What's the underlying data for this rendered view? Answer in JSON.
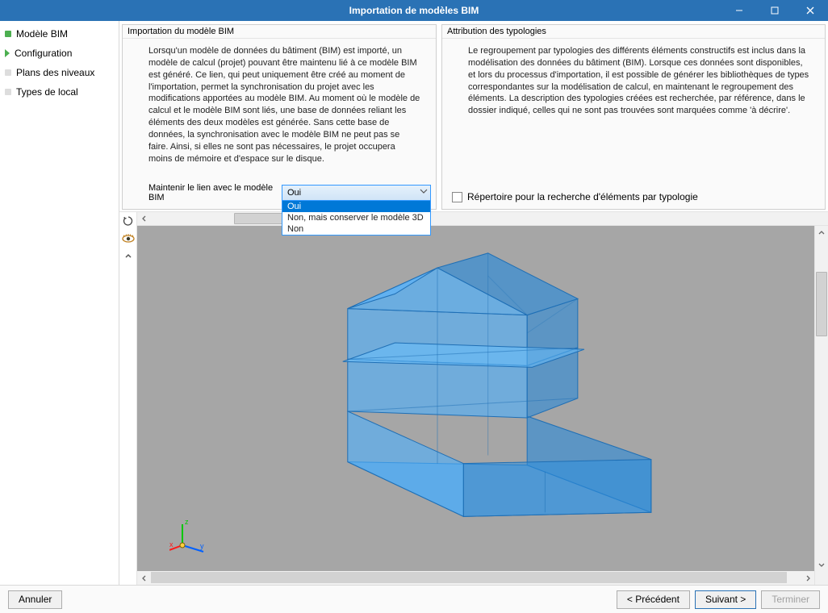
{
  "window": {
    "title": "Importation de modèles BIM"
  },
  "sidebar": {
    "items": [
      {
        "label": "Modèle BIM",
        "state": "done"
      },
      {
        "label": "Configuration",
        "state": "current"
      },
      {
        "label": "Plans des niveaux",
        "state": "pending"
      },
      {
        "label": "Types de local",
        "state": "pending"
      }
    ]
  },
  "panels": {
    "left": {
      "title": "Importation du modèle BIM",
      "text": "Lorsqu'un modèle de données du bâtiment (BIM) est importé, un modèle de calcul (projet) pouvant être maintenu lié à ce modèle BIM est généré. Ce lien, qui peut uniquement être créé au moment de l'importation, permet la synchronisation du projet avec les modifications apportées au modèle BIM. Au moment où le modèle de calcul et le modèle BIM sont liés, une base de données reliant les éléments des deux modèles est générée. Sans cette base de données, la synchronisation avec le modèle BIM ne peut pas se faire. Ainsi, si elles ne sont pas nécessaires, le projet occupera moins de mémoire et d'espace sur le disque.",
      "comboLabel": "Maintenir le lien avec le modèle BIM",
      "comboValue": "Oui",
      "comboOptions": [
        "Oui",
        "Non, mais conserver le modèle 3D",
        "Non"
      ]
    },
    "right": {
      "title": "Attribution des typologies",
      "text": "Le regroupement par typologies des différents éléments constructifs est inclus dans la modélisation des données du bâtiment (BIM). Lorsque ces données sont disponibles, et lors du processus d'importation, il est possible de générer les bibliothèques de types correspondantes sur la modélisation de calcul, en maintenant le regroupement des éléments. La description des typologies créées est recherchée, par référence, dans le dossier indiqué, celles qui ne sont pas trouvées sont marquées comme 'à décrire'.",
      "checkLabel": "Répertoire pour la recherche d'éléments par typologie"
    }
  },
  "footer": {
    "cancel": "Annuler",
    "prev": "< Précédent",
    "next": "Suivant >",
    "finish": "Terminer"
  },
  "axis": {
    "x": "x",
    "y": "y",
    "z": "z"
  }
}
